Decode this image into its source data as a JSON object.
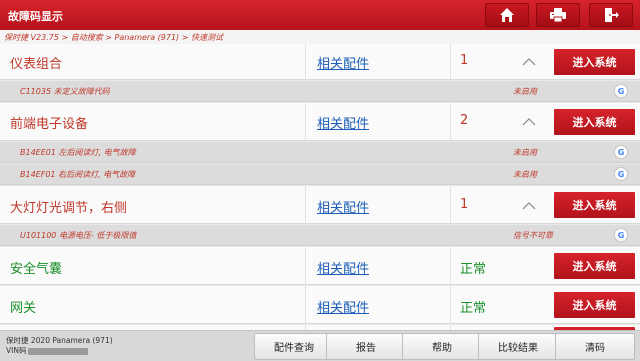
{
  "header": {
    "title": "故障码显示",
    "home_icon": "home-icon",
    "print_icon": "printer-icon",
    "exit_icon": "exit-icon"
  },
  "breadcrumb": "保时捷 V23.75 > 自动搜索 > Panamera (971) > 快速测试",
  "systems": [
    {
      "name": "仪表组合",
      "parts": "相关配件",
      "count": "1",
      "enter": "进入系统",
      "faults": [
        {
          "code": "C11035 未定义故障代码",
          "state": "未启用"
        }
      ]
    },
    {
      "name": "前端电子设备",
      "parts": "相关配件",
      "count": "2",
      "enter": "进入系统",
      "faults": [
        {
          "code": "B14EE01 左后阅读灯, 电气故障",
          "state": "未启用"
        },
        {
          "code": "B14EF01 右后阅读灯, 电气故障",
          "state": "未启用"
        }
      ]
    },
    {
      "name": "大灯灯光调节，右侧",
      "parts": "相关配件",
      "count": "1",
      "enter": "进入系统",
      "faults": [
        {
          "code": "U101100 电源电压- 低于极限值",
          "state": "信号不可靠"
        }
      ]
    },
    {
      "name": "安全气囊",
      "parts": "相关配件",
      "count": "正常",
      "enter": "进入系统",
      "faults": []
    },
    {
      "name": "网关",
      "parts": "相关配件",
      "count": "正常",
      "enter": "进入系统",
      "faults": []
    }
  ],
  "footer": {
    "vehicle": "保时捷 2020 Panamera (971)",
    "vin_label": "VIN码",
    "buttons": [
      "配件查询",
      "报告",
      "帮助",
      "比较结果",
      "清码"
    ]
  },
  "colors": {
    "accent": "#c8161f",
    "fault_text": "#c0392b",
    "ok_text": "#1a8f2a",
    "link": "#1d5fb8"
  }
}
